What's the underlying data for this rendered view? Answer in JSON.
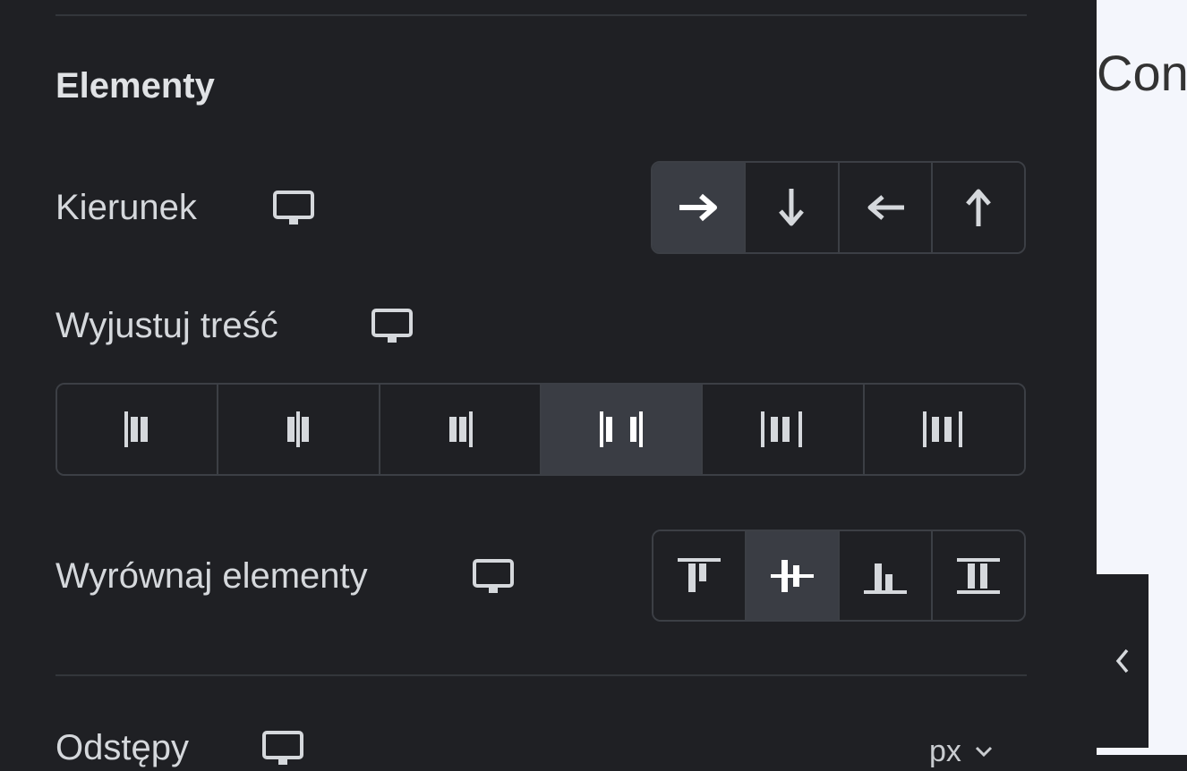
{
  "preview": {
    "text": "Con"
  },
  "section": {
    "title": "Elementy"
  },
  "direction": {
    "label": "Kierunek",
    "device_icon": "desktop-icon",
    "options": [
      {
        "icon": "arrow-right-icon",
        "active": true
      },
      {
        "icon": "arrow-down-icon",
        "active": false
      },
      {
        "icon": "arrow-left-icon",
        "active": false
      },
      {
        "icon": "arrow-up-icon",
        "active": false
      }
    ]
  },
  "justify": {
    "label": "Wyjustuj treść",
    "device_icon": "desktop-icon",
    "options": [
      {
        "icon": "justify-start-icon",
        "active": false
      },
      {
        "icon": "justify-center-icon",
        "active": false
      },
      {
        "icon": "justify-end-icon",
        "active": false
      },
      {
        "icon": "justify-space-between-icon",
        "active": true
      },
      {
        "icon": "justify-space-around-icon",
        "active": false
      },
      {
        "icon": "justify-space-evenly-icon",
        "active": false
      }
    ]
  },
  "align": {
    "label": "Wyrównaj elementy",
    "device_icon": "desktop-icon",
    "options": [
      {
        "icon": "align-start-icon",
        "active": false
      },
      {
        "icon": "align-center-icon",
        "active": true
      },
      {
        "icon": "align-end-icon",
        "active": false
      },
      {
        "icon": "align-stretch-icon",
        "active": false
      }
    ]
  },
  "gaps": {
    "label": "Odstępy",
    "device_icon": "desktop-icon",
    "unit": "px",
    "unit_chevron": "chevron-down-icon"
  },
  "collapse_icon": "chevron-left-icon",
  "colors": {
    "panel_bg": "#1f2024",
    "active_bg": "#3a3d44",
    "border": "#3c3f45",
    "preview_bg": "#f4f6fc"
  }
}
